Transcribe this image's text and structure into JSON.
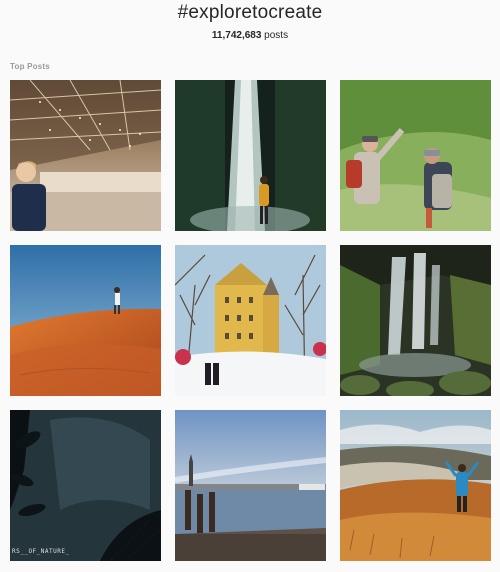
{
  "tag": {
    "title": "#exploretocreate",
    "post_count": "11,742,683",
    "post_suffix": " posts"
  },
  "section": {
    "label": "Top Posts"
  },
  "posts": [
    {
      "subject": "boy-in-wooden-hall",
      "accent": "#e8d9b8"
    },
    {
      "subject": "waterfall-person-yellow-jacket",
      "accent": "#1e2f2a"
    },
    {
      "subject": "hikers-pointing-green-hill",
      "accent": "#7aa24a"
    },
    {
      "subject": "person-on-sand-dune",
      "accent": "#c8642a"
    },
    {
      "subject": "yellow-castle-snow",
      "accent": "#e0b74a"
    },
    {
      "subject": "mossy-waterfall",
      "accent": "#3a4a30"
    },
    {
      "subject": "dark-foliage",
      "accent": "#20303a",
      "caption": "RS__OF_NATURE_"
    },
    {
      "subject": "venice-lagoon-pier",
      "accent": "#8fa6c0"
    },
    {
      "subject": "hiker-cheering-valley",
      "accent": "#c47a2a"
    }
  ]
}
